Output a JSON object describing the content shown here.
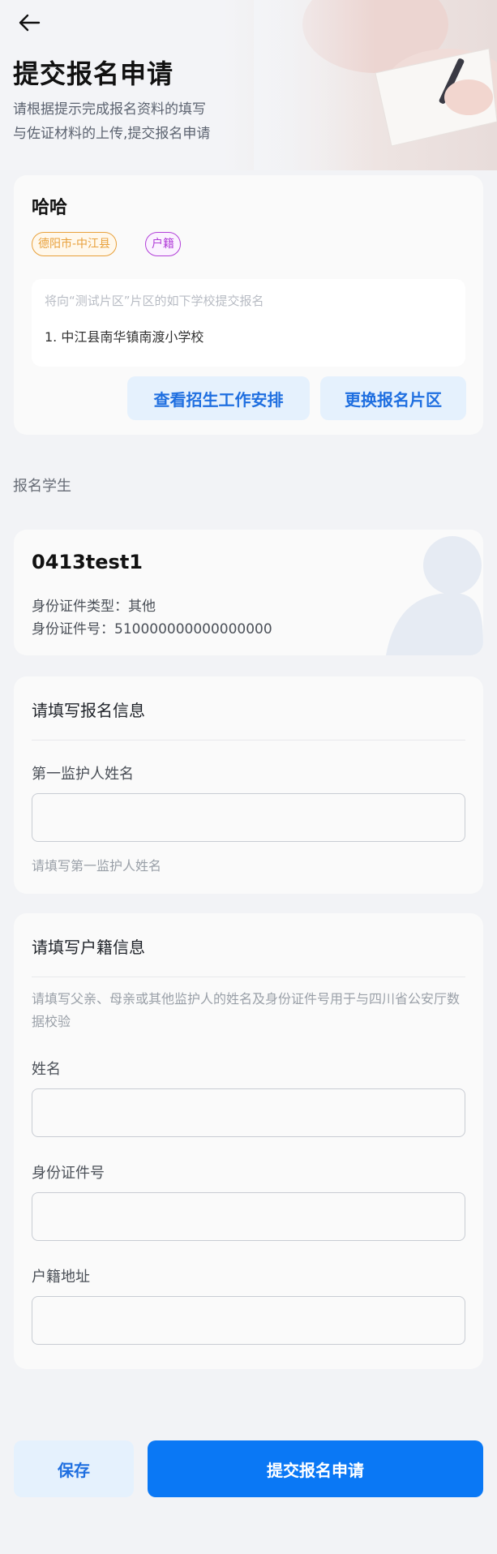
{
  "header": {
    "back_icon": "arrow-left-icon",
    "title": "提交报名申请",
    "description_line1": "请根据提示完成报名资料的填写",
    "description_line2": "与佐证材料的上传,提交报名申请"
  },
  "school_card": {
    "name": "哈哈",
    "tag_area": "德阳市-中江县",
    "tag_hukou": "户籍",
    "hint": "将向“测试片区”片区的如下学校提交报名",
    "schools": [
      "1. 中江县南华镇南渡小学校"
    ],
    "schedule_button": "查看招生工作安排",
    "change_button": "更换报名片区",
    "colors": {
      "tag_area": "#e8a03a",
      "tag_hukou": "#b23fd8"
    }
  },
  "student_section": {
    "label": "报名学生",
    "name": "0413test1",
    "id_type_line": "身份证件类型：其他",
    "id_number_line": "身份证件号：510000000000000000"
  },
  "form_signup": {
    "title": "请填写报名信息",
    "guardian_label": "第一监护人姓名",
    "guardian_value": "",
    "guardian_help": "请填写第一监护人姓名"
  },
  "form_hukou": {
    "title": "请填写户籍信息",
    "description": "请填写父亲、母亲或其他监护人的姓名及身份证件号用于与四川省公安厅数据校验",
    "name_label": "姓名",
    "name_value": "",
    "id_label": "身份证件号",
    "id_value": "",
    "address_label": "户籍地址",
    "address_value": ""
  },
  "actions": {
    "save": "保存",
    "submit": "提交报名申请",
    "colors": {
      "primary": "#0a78f5",
      "light": "#e5f1fd"
    }
  }
}
